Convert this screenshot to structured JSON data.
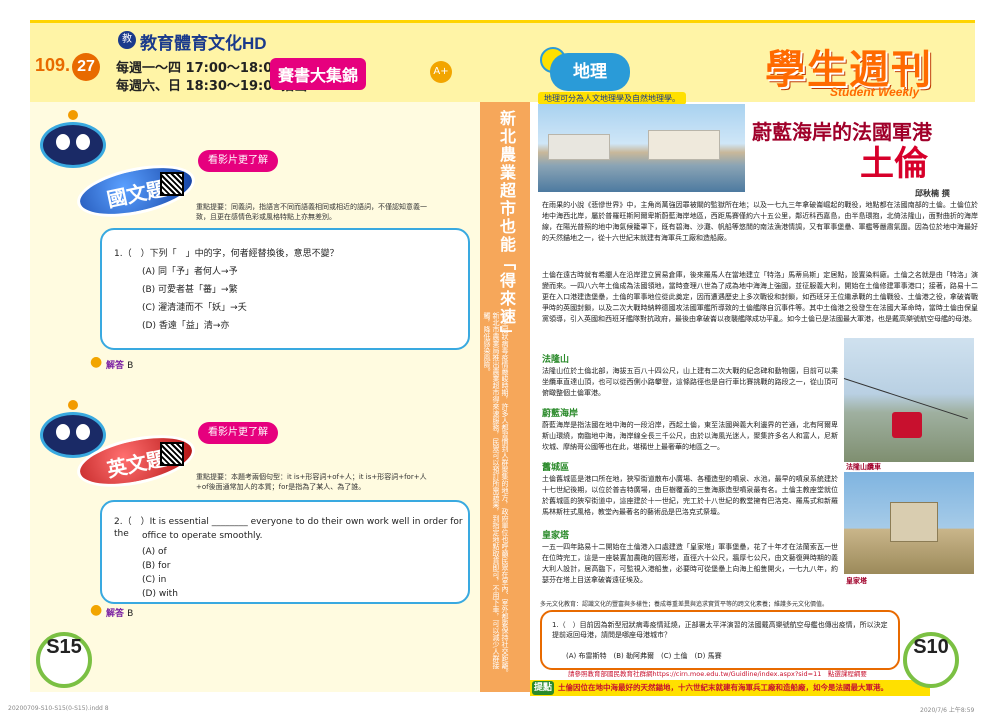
{
  "header": {
    "issue_prefix": "109.",
    "issue_number": "27",
    "tv_name": "教育體育文化HD",
    "schedule_weekday": "每週一～四 17:00～18:00播出",
    "schedule_weekend": "每週六、日 18:30～19:00播出",
    "program_title": "賽書大集錦",
    "program_badge": "A+",
    "section_logo": "地理",
    "weekly_title": "學生週刊",
    "weekly_subtitle": "Student Weekly"
  },
  "left_page": {
    "chinese": {
      "subject": "國文題",
      "watch_video": "看影片更了解",
      "note": "重點提要：同義詞，指語言不同而語義相同或相近的語詞，不僅認知意義一致，且更在感情色彩或風格特點上亦無差別。",
      "question": "1.（　）下列「　」中的字，何者經替換後，意思不變？",
      "options": [
        "(A) 同「予」者何人→予",
        "(B) 可愛者甚「蕃」→繁",
        "(C) 濯清漣而不「妖」→夭",
        "(D) 香遠「益」清→亦"
      ],
      "answer_label": "解答",
      "answer_value": "B"
    },
    "english": {
      "subject": "英文題",
      "watch_video": "看影片更了解",
      "note": "重點提要：本題考兩個句型：it is+形容詞+of+人；it is+形容詞+for+人+of後面通常加人的本質；for是指為了某人、為了誰。",
      "question_line1": "2.（　）It is essential ________ everyone to do their own work well in order for the",
      "question_line2": "office to operate smoothly.",
      "options": [
        "(A) of",
        "(B) for",
        "(C) in",
        "(D) with"
      ],
      "answer_label": "解答",
      "answer_value": "B"
    },
    "page_number": "S15"
  },
  "vertical_column": {
    "heading": "新北農業超市也能「得來速」",
    "body": "新型冠狀病毒疫情嚴峻時期，許多人都習慣到人群聚集的地方，政府單位也呼籲民眾在室內、室外都要保持社交距離。新北市農業局推出農業超市得來速服務，民眾可以預訂所需蔬果，到指定地點取貨即可，不用下車，可以減少人群接觸，降低感染風險。"
  },
  "right_page": {
    "tagline": "地理可分為人文地理學及自然地理學。",
    "title_main": "蔚藍海岸的法國軍港",
    "title_big": "土倫",
    "author": "邱秋楠 撰",
    "intro": "在雨果的小說《悲慘世界》中，主角尚萬強因罪被關的監獄所在地；以及一七九三年拿破崙崛起的戰役，地點都在法國南部的土倫。土倫位於地中海西北岸，屬於普羅旺斯阿爾卑斯蔚藍海岸地區，西距馬賽僅約六十五公里，鄰近科西嘉島，由半島環抱，北倚法隆山，面對曲折的海岸線，在陽光普照的地中海氣候籠罩下，既有碧海、沙灘、帆船等悠閒的南法漁港情調，又有軍事堡壘、軍艦等嚴肅氣圍。因為位於地中海最好的天然錨地之一，從十六世紀末就建有海軍兵工廠和造船廠。",
    "history": "土倫在遠古時就有希臘人在沿岸建立貿易倉庫，後來羅馬人在當地建立「特洛」馬蒂烏斯」定居點，設置染料廠。土倫之名就是由「特洛」演變而來。一四八六年土倫成為法國領地，當時查理八世為了成為地中海海上強國，並征服義大利，開始在土倫修建軍事港口；接著，路易十二更在入口港建造堡壘，土倫的軍事地位從此奠定，因而遭遇歷史上多次戰役和封鎖，如西班牙王位繼承戰的土倫戰役、土倫港之役，拿破崙戰爭時的英國封鎖，以及二次大戰時納粹德國攻法國軍艦所導致的土倫艦隊自沉事件等。其中土倫港之役發生在法國大革命時，當時土倫由保皇黨領導，引入英國和西班牙艦隊對抗政府，最後由拿破崙以夜襲艦隊成功平亂。如今土倫已是法國最大軍港，也是戴高樂號航空母艦的母港。",
    "sections": [
      {
        "heading": "法隆山",
        "text": "法隆山位於土倫北部，海拔五百八十四公尺，山上建有二次大戰的紀念碑和動物園，目前可以乘坐纜車直達山頂，也可以從西側小路攀登，這條路徑也是自行車比賽挑戰的路段之一，從山頂可俯瞰整個土倫軍港。"
      },
      {
        "heading": "蔚藍海岸",
        "text": "蔚藍海岸是指法國在地中海的一段沿岸，西起土倫，東至法國與義大利邊界的芒通，北有阿爾卑斯山環繞，南臨地中海，海岸線全長三千公尺，由於以海風光迷人，聚集許多名人和富人，尼斯坎城、摩納哥公國等也在此，堪稱世上最奢華的地區之一。"
      },
      {
        "heading": "舊城區",
        "text": "土倫舊城區是港口所在地，狹窄街道散布小廣場、各種造型的噴泉、水池，最早的噴泉系統建於十七世紀後期，以位於普吉特廣場，由巨樹覆蓋的三隻海豚造型噴泉最有名。土倫主教座堂就位於舊城區的狹窄街道中，這座建於十一世紀，完工於十八世紀的教堂擁有巴洛克、羅馬式和新羅馬林斯柱式風格，教堂內最著名的藝術品是巴洛克式祭壇。"
      },
      {
        "heading": "皇家塔",
        "text": "一五一四年路易十二開始在土倫港入口處建造「皇家塔」軍事堡壘，花了十年才在法蘭索瓦一世在位時完工，這是一座裝置加農砲的圓形塔，直徑六十公尺，牆厚七公尺，由文藝復興時期的義大利人設計，居高臨下，可監視入港船隻，必要時可從堡壘上向海上船隻開火，一七九八年，約瑟芬在塔上目送拿破崙遠征埃及。"
      }
    ],
    "caption_cable": "法隆山纜車",
    "caption_tower": "皇家塔",
    "edu_note": "多元文化教育：認識文化的豐富與多樣性；養成尊重差異與追求實質平等的跨文化素養；維護多元文化價值。",
    "quiz": "1.（　）目前因為新型冠狀病毒疫情延燒，正部署太平洋演習的法國戴高樂號航空母艦也傳出疫情，所以決定提前返回母港，請問是哪座母港城市？",
    "quiz_options": "(A) 布雷斯特　(B) 勒阿弗爾　(C) 土倫　(D) 馬賽",
    "url_line": "請參照教育部國民教育社群網https://cirn.moe.edu.tw/Guidline/index.aspx?sid=11　點選課程綱要",
    "hint_badge": "提點",
    "hint_text": "土倫因位在地中海最好的天然錨地，十六世紀末就建有海軍兵工廠和造船廠，如今是法國最大軍港。",
    "page_number": "S10"
  },
  "footer": {
    "left": "20200709-S10-S15(0-S15).indd 8",
    "right": "2020/7/6 上午8:59"
  }
}
